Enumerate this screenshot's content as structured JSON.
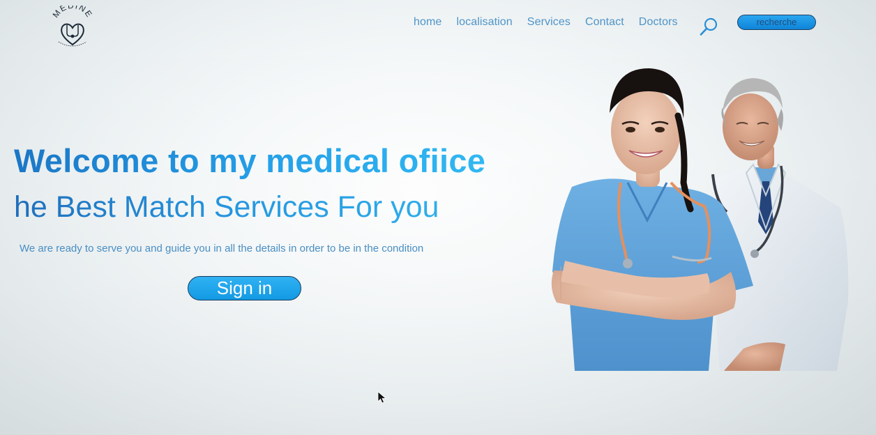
{
  "header": {
    "logo": {
      "text": "MEDINE",
      "icon": "stethoscope-heart-icon"
    },
    "nav": {
      "items": [
        {
          "label": "home"
        },
        {
          "label": "localisation"
        },
        {
          "label": "Services"
        },
        {
          "label": "Contact"
        },
        {
          "label": "Doctors"
        }
      ]
    },
    "search": {
      "icon": "search-icon",
      "button_label": "recherche"
    }
  },
  "hero": {
    "title": "Welcome to my medical ofiice",
    "subtitle": "he Best Match Services For you",
    "description": "We are ready to serve you and guide you in all the details in order to be in the condition",
    "signin_label": "Sign in",
    "image": {
      "subject": "nurse-and-doctor-photo"
    }
  },
  "colors": {
    "accent": "#25a2ea",
    "nav_text": "#4e94c8",
    "button_fill": "#129be5",
    "button_border": "#1b3d5f",
    "title_dark": "#1b77c7",
    "title_light": "#31b9f3"
  }
}
